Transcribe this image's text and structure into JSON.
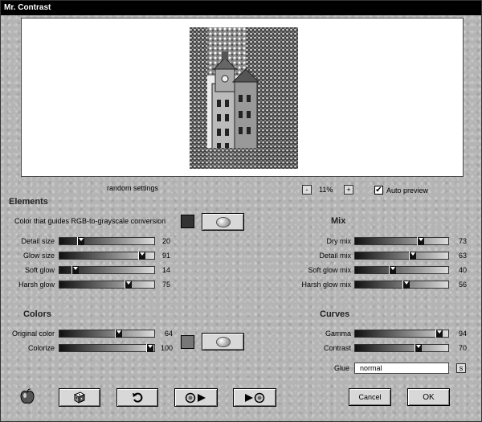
{
  "window": {
    "title": "Mr. Contrast"
  },
  "preview": {
    "random_settings": "random settings",
    "zoom": "11%",
    "zoom_minus": "-",
    "zoom_plus": "+",
    "auto_preview_label": "Auto preview",
    "auto_preview_checked": true
  },
  "elements": {
    "heading": "Elements",
    "color_label": "Color that guides RGB-to-grayscale conversion",
    "color_swatch": "#333333",
    "sliders": [
      {
        "label": "Detail size",
        "value": "20"
      },
      {
        "label": "Glow size",
        "value": "91"
      },
      {
        "label": "Soft glow",
        "value": "14"
      },
      {
        "label": "Harsh glow",
        "value": "75"
      }
    ]
  },
  "mix": {
    "heading": "Mix",
    "sliders": [
      {
        "label": "Dry mix",
        "value": "73"
      },
      {
        "label": "Detail mix",
        "value": "63"
      },
      {
        "label": "Soft glow mix",
        "value": "40"
      },
      {
        "label": "Harsh glow mix",
        "value": "56"
      }
    ]
  },
  "colors": {
    "heading": "Colors",
    "swatch": "#777777",
    "sliders": [
      {
        "label": "Original color",
        "value": "64"
      },
      {
        "label": "Colorize",
        "value": "100"
      }
    ]
  },
  "curves": {
    "heading": "Curves",
    "sliders": [
      {
        "label": "Gamma",
        "value": "94"
      },
      {
        "label": "Contrast",
        "value": "70"
      }
    ],
    "glue_label": "Glue",
    "glue_value": "normal",
    "glue_button": "s"
  },
  "footer": {
    "cancel": "Cancel",
    "ok": "OK"
  },
  "icons": {
    "app": "apple-icon",
    "dice": "dice-icon",
    "undo": "undo-icon",
    "prev": "play-back-icon",
    "next": "play-forward-icon"
  }
}
